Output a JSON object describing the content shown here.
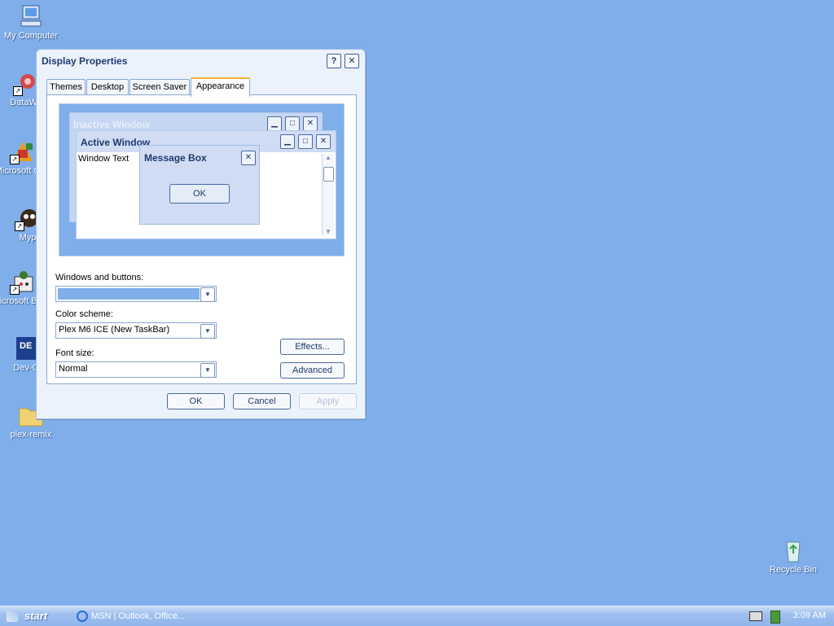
{
  "desktop": {
    "icons": [
      {
        "label": "My Computer",
        "icon": "computer-icon"
      },
      {
        "label": "DataWa",
        "icon": "datawa-icon"
      },
      {
        "label": "Microsoft C++",
        "icon": "vcpp-icon"
      },
      {
        "label": "Myp",
        "icon": "myp-icon"
      },
      {
        "label": "Microsoft Basic",
        "icon": "vb-icon"
      },
      {
        "label": "Dev-C",
        "icon": "devc-icon"
      },
      {
        "label": "plex-remix",
        "icon": "folder-icon"
      },
      {
        "label": "Recycle Bin",
        "icon": "recycle-bin-icon"
      }
    ]
  },
  "dialog": {
    "title": "Display Properties",
    "help_btn": "?",
    "close_btn": "✕",
    "tabs": [
      "Themes",
      "Desktop",
      "Screen Saver",
      "Appearance"
    ],
    "active_tab": "Appearance",
    "preview": {
      "inactive_title": "Inactive Window",
      "active_title": "Active Window",
      "window_text": "Window Text",
      "message_title": "Message Box",
      "message_ok": "OK",
      "min_glyph": "▁",
      "max_glyph": "□",
      "close_glyph": "✕",
      "up_glyph": "▲",
      "down_glyph": "▼"
    },
    "windows_buttons_label": "Windows and buttons:",
    "windows_buttons_value": "",
    "color_scheme_label": "Color scheme:",
    "color_scheme_value": "Plex M6 ICE (New TaskBar)",
    "font_size_label": "Font size:",
    "font_size_value": "Normal",
    "dropdown_glyph": "▼",
    "effects_btn": "Effects...",
    "advanced_btn": "Advanced",
    "ok_btn": "OK",
    "cancel_btn": "Cancel",
    "apply_btn": "Apply"
  },
  "taskbar": {
    "start_label": "start",
    "task_item": "MSN | Outlook, Office...",
    "clock": "3:09 AM"
  },
  "colors": {
    "desktop": "#7faeea",
    "accent": "#f1b431"
  }
}
